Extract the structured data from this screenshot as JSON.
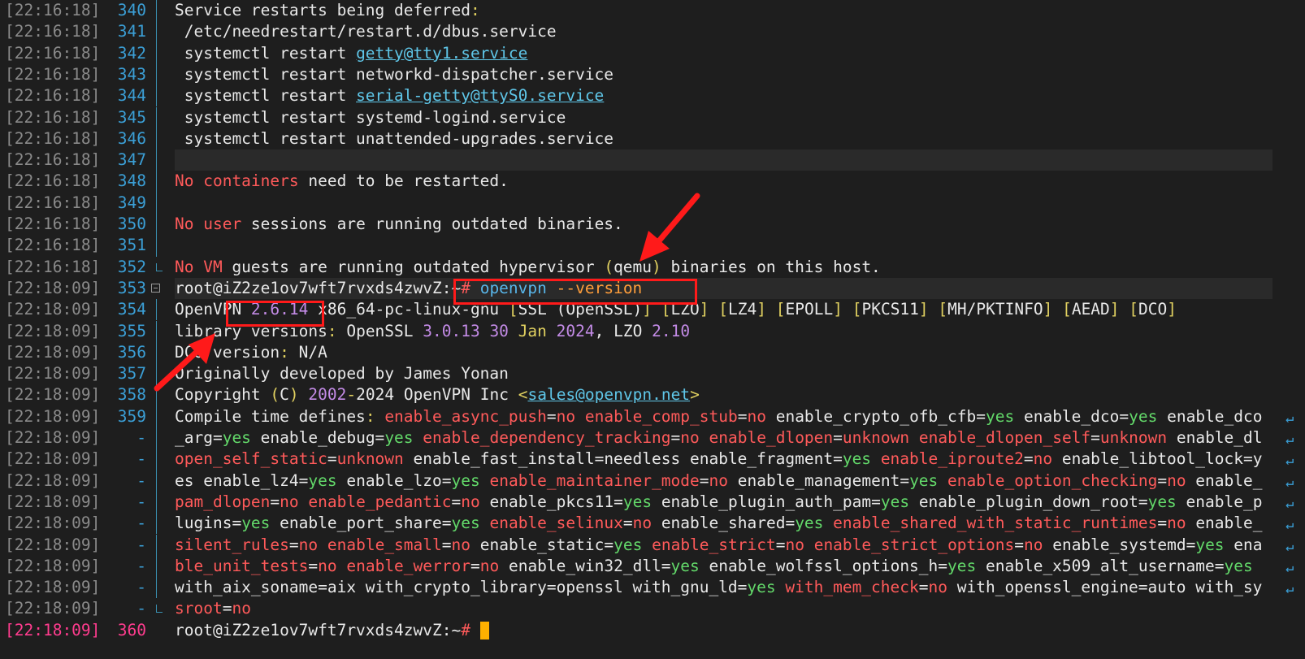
{
  "colors": {
    "background": "#1e1e1e",
    "line_number": "#3b9fd6",
    "annotation": "#ff1a1a",
    "cursor": "#ffb000"
  },
  "lines": [
    {
      "ts": "[22:16:18]",
      "ln": "340",
      "text": "Service restarts being deferred:"
    },
    {
      "ts": "[22:16:18]",
      "ln": "341",
      "text": " /etc/needrestart/restart.d/dbus.service"
    },
    {
      "ts": "[22:16:18]",
      "ln": "342",
      "text": " systemctl restart getty@tty1.service"
    },
    {
      "ts": "[22:16:18]",
      "ln": "343",
      "text": " systemctl restart networkd-dispatcher.service"
    },
    {
      "ts": "[22:16:18]",
      "ln": "344",
      "text": " systemctl restart serial-getty@ttyS0.service"
    },
    {
      "ts": "[22:16:18]",
      "ln": "345",
      "text": " systemctl restart systemd-logind.service"
    },
    {
      "ts": "[22:16:18]",
      "ln": "346",
      "text": " systemctl restart unattended-upgrades.service"
    },
    {
      "ts": "[22:16:18]",
      "ln": "347",
      "text": ""
    },
    {
      "ts": "[22:16:18]",
      "ln": "348",
      "text": "No containers need to be restarted."
    },
    {
      "ts": "[22:16:18]",
      "ln": "349",
      "text": ""
    },
    {
      "ts": "[22:16:18]",
      "ln": "350",
      "text": "No user sessions are running outdated binaries."
    },
    {
      "ts": "[22:16:18]",
      "ln": "351",
      "text": ""
    },
    {
      "ts": "[22:16:18]",
      "ln": "352",
      "text": "No VM guests are running outdated hypervisor (qemu) binaries on this host."
    },
    {
      "ts": "[22:18:09]",
      "ln": "353",
      "text": "root@iZ2ze1ov7wft7rvxds4zwvZ:~# openvpn --version"
    },
    {
      "ts": "[22:18:09]",
      "ln": "354",
      "text": "OpenVPN 2.6.14 x86_64-pc-linux-gnu [SSL (OpenSSL)] [LZO] [LZ4] [EPOLL] [PKCS11] [MH/PKTINFO] [AEAD] [DCO]"
    },
    {
      "ts": "[22:18:09]",
      "ln": "355",
      "text": "library versions: OpenSSL 3.0.13 30 Jan 2024, LZO 2.10"
    },
    {
      "ts": "[22:18:09]",
      "ln": "356",
      "text": "DCO version: N/A"
    },
    {
      "ts": "[22:18:09]",
      "ln": "357",
      "text": "Originally developed by James Yonan"
    },
    {
      "ts": "[22:18:09]",
      "ln": "358",
      "text": "Copyright (C) 2002-2024 OpenVPN Inc <sales@openvpn.net>"
    },
    {
      "ts": "[22:18:09]",
      "ln": "359",
      "text": "Compile time defines: enable_async_push=no enable_comp_stub=no enable_crypto_ofb_cfb=yes enable_dco=yes enable_dco"
    },
    {
      "ts": "[22:18:09]",
      "ln": "-",
      "text": "_arg=yes enable_debug=yes enable_dependency_tracking=no enable_dlopen=unknown enable_dlopen_self=unknown enable_dl"
    },
    {
      "ts": "[22:18:09]",
      "ln": "-",
      "text": "open_self_static=unknown enable_fast_install=needless enable_fragment=yes enable_iproute2=no enable_libtool_lock=y"
    },
    {
      "ts": "[22:18:09]",
      "ln": "-",
      "text": "es enable_lz4=yes enable_lzo=yes enable_maintainer_mode=no enable_management=yes enable_option_checking=no enable_"
    },
    {
      "ts": "[22:18:09]",
      "ln": "-",
      "text": "pam_dlopen=no enable_pedantic=no enable_pkcs11=yes enable_plugin_auth_pam=yes enable_plugin_down_root=yes enable_p"
    },
    {
      "ts": "[22:18:09]",
      "ln": "-",
      "text": "lugins=yes enable_port_share=yes enable_selinux=no enable_shared=yes enable_shared_with_static_runtimes=no enable_"
    },
    {
      "ts": "[22:18:09]",
      "ln": "-",
      "text": "silent_rules=no enable_small=no enable_static=yes enable_strict=no enable_strict_options=no enable_systemd=yes ena"
    },
    {
      "ts": "[22:18:09]",
      "ln": "-",
      "text": "ble_unit_tests=no enable_werror=no enable_win32_dll=yes enable_wolfssl_options_h=yes enable_x509_alt_username=yes "
    },
    {
      "ts": "[22:18:09]",
      "ln": "-",
      "text": "with_aix_soname=aix with_crypto_library=openssl with_gnu_ld=yes with_mem_check=no with_openssl_engine=auto with_sy"
    },
    {
      "ts": "[22:18:09]",
      "ln": "-",
      "text": "sroot=no"
    },
    {
      "ts": "[22:18:09]",
      "ln": "360",
      "text": "root@iZ2ze1ov7wft7rvxds4zwvZ:~# "
    }
  ]
}
